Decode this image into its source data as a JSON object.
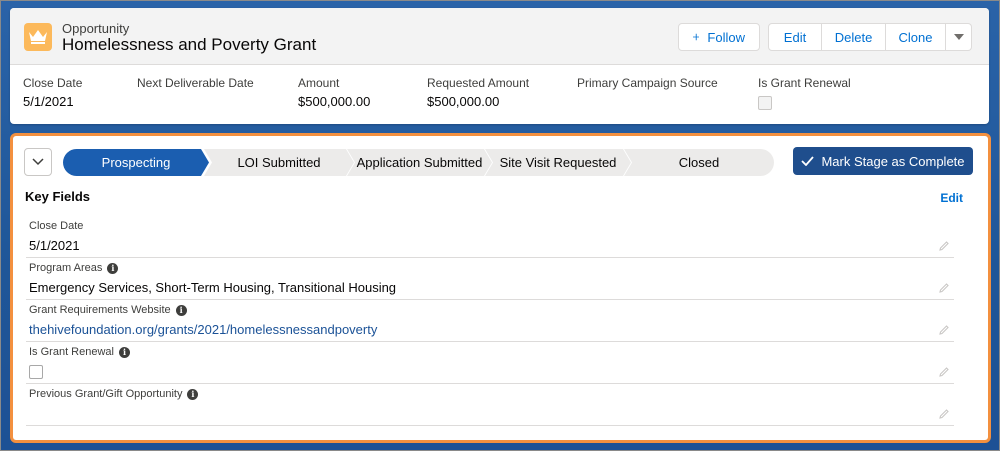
{
  "record": {
    "object_type": "Opportunity",
    "title": "Homelessness and Poverty Grant"
  },
  "actions": {
    "follow": "Follow",
    "edit": "Edit",
    "delete": "Delete",
    "clone": "Clone"
  },
  "highlights": [
    {
      "label": "Close Date",
      "value": "5/1/2021"
    },
    {
      "label": "Next Deliverable Date",
      "value": ""
    },
    {
      "label": "Amount",
      "value": "$500,000.00"
    },
    {
      "label": "Requested Amount",
      "value": "$500,000.00"
    },
    {
      "label": "Primary Campaign Source",
      "value": ""
    },
    {
      "label": "Is Grant Renewal",
      "checked": false
    }
  ],
  "path": {
    "stages": [
      "Prospecting",
      "LOI Submitted",
      "Application Submitted",
      "Site Visit Requested",
      "Closed"
    ],
    "active_stage": "Prospecting",
    "mark_complete_label": "Mark Stage as Complete"
  },
  "key_fields": {
    "title": "Key Fields",
    "edit_label": "Edit",
    "fields": [
      {
        "label": "Close Date",
        "value": "5/1/2021"
      },
      {
        "label": "Program Areas",
        "value": "Emergency Services, Short-Term Housing, Transitional Housing"
      },
      {
        "label": "Grant Requirements Website",
        "value": "thehivefoundation.org/grants/2021/homelessnessandpoverty"
      },
      {
        "label": "Is Grant Renewal",
        "checked": false
      },
      {
        "label": "Previous Grant/Gift Opportunity",
        "value": ""
      }
    ]
  },
  "colors": {
    "brand_blue": "#1b5eb0",
    "link_blue": "#0070d2",
    "highlight_orange": "#f3903f",
    "object_icon": "#fcb95b"
  },
  "icons": {
    "object": "crown-icon",
    "follow": "plus-icon",
    "more": "chevron-down-icon",
    "toggle": "chevron-down-icon",
    "mark_complete": "checkmark-icon",
    "info": "info-icon",
    "edit_field": "pencil-icon"
  }
}
